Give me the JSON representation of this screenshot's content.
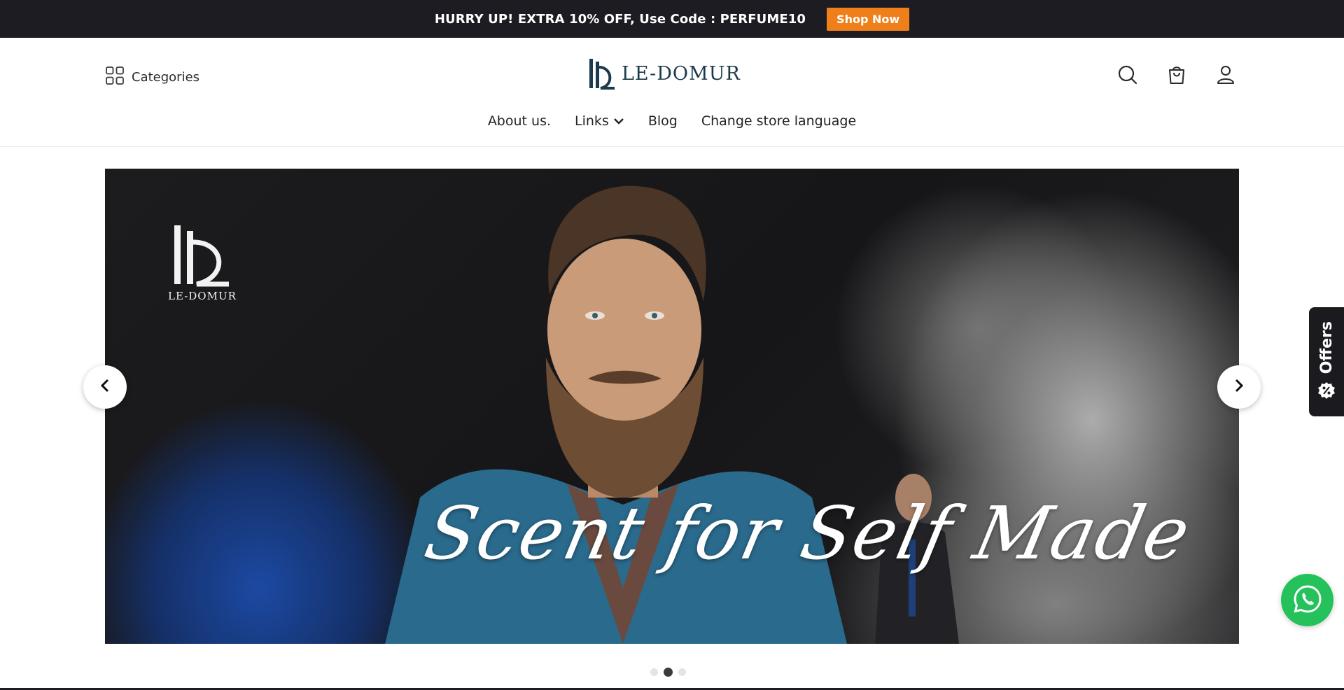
{
  "announcement": {
    "text": "HURRY UP! EXTRA 10% OFF, Use Code : PERFUME10",
    "button_label": "Shop Now"
  },
  "header": {
    "categories_label": "Categories",
    "logo_text": "LE-DOMUR",
    "icons": [
      "search-icon",
      "cart-icon",
      "account-icon"
    ]
  },
  "nav": {
    "items": [
      {
        "label": "About us."
      },
      {
        "label": "Links",
        "has_dropdown": true
      },
      {
        "label": "Blog"
      },
      {
        "label": "Change store language"
      }
    ]
  },
  "hero": {
    "logo_text": "LE-DOMUR",
    "caption": "Scent for Self Made",
    "slide_count": 3,
    "active_slide": 2
  },
  "offers_tab": {
    "label": "Offers"
  },
  "colors": {
    "announcement_bg": "#1d1c23",
    "accent": "#ef7f1a",
    "brand": "#1b3a4b",
    "whatsapp": "#25c15a"
  }
}
